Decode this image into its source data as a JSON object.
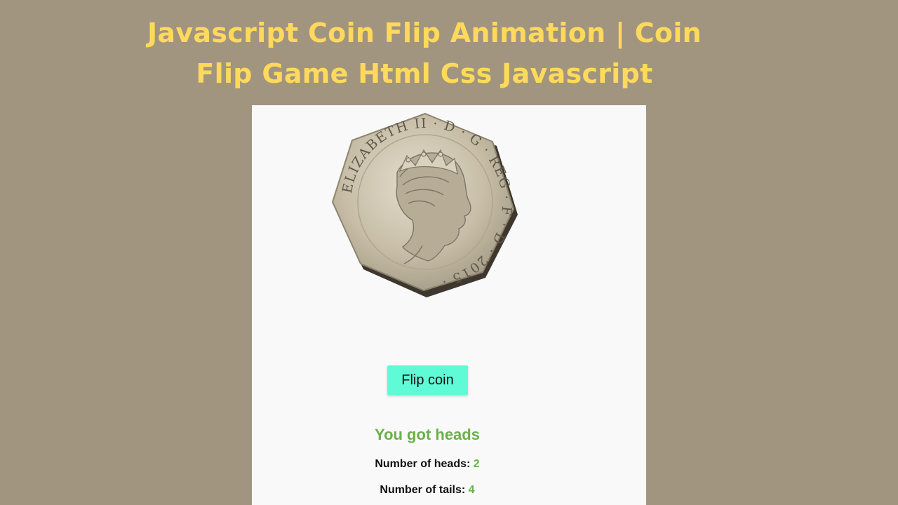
{
  "banner": {
    "title_line1": "Javascript Coin Flip Animation | Coin",
    "title_line2": "Flip Game Html Css Javascript"
  },
  "coin": {
    "face": "heads",
    "inscription": "ELIZABETH II · D · G · REG · F · D · 2015 · "
  },
  "controls": {
    "flip_label": "Flip coin"
  },
  "result": {
    "message": "You got heads"
  },
  "stats": {
    "heads_label": "Number of heads:",
    "heads_value": "2",
    "tails_label": "Number of tails:",
    "tails_value": "4"
  },
  "colors": {
    "background": "#a1957f",
    "title": "#ffd95c",
    "button": "#5ffbd6",
    "accent_green": "#6ab04c"
  }
}
